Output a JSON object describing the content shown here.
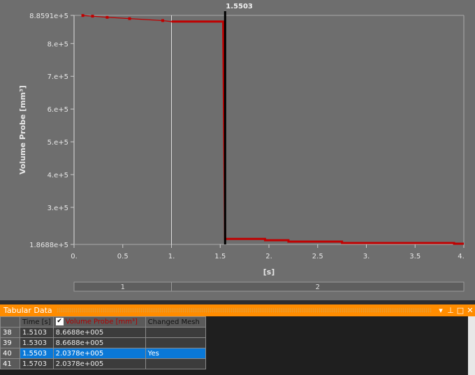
{
  "chart_data": {
    "type": "line",
    "ylabel": "Volume Probe [mm³]",
    "xlabel": "[s]",
    "xlim": [
      0,
      4
    ],
    "ylim": [
      186880,
      885910
    ],
    "xticks": [
      "0.",
      "0.5",
      "1.",
      "1.5",
      "2.",
      "2.5",
      "3.",
      "3.5",
      "4."
    ],
    "yticks": [
      {
        "v": 885910,
        "label": "8.8591e+5"
      },
      {
        "v": 800000,
        "label": "8.e+5"
      },
      {
        "v": 700000,
        "label": "7.e+5"
      },
      {
        "v": 600000,
        "label": "6.e+5"
      },
      {
        "v": 500000,
        "label": "5.e+5"
      },
      {
        "v": 400000,
        "label": "4.e+5"
      },
      {
        "v": 300000,
        "label": "3.e+5"
      },
      {
        "v": 186880,
        "label": "1.8688e+5"
      }
    ],
    "cursor": {
      "x": 1.5503,
      "label": "1.5503"
    },
    "step_divider": 1.0,
    "steps": [
      "1",
      "2"
    ],
    "series": [
      {
        "name": "Volume Probe [mm³]",
        "color": "#c00000",
        "points": [
          [
            0.09,
            885500
          ],
          [
            0.19,
            883500
          ],
          [
            0.34,
            880000
          ],
          [
            0.57,
            876000
          ],
          [
            0.91,
            870000
          ],
          [
            1.0,
            866880
          ],
          [
            1.5303,
            866880
          ],
          [
            1.5503,
            203780
          ],
          [
            1.96,
            203780
          ],
          [
            1.96,
            199700
          ],
          [
            2.2,
            199700
          ],
          [
            2.2,
            195500
          ],
          [
            2.75,
            195500
          ],
          [
            2.75,
            191200
          ],
          [
            3.9,
            191200
          ],
          [
            3.9,
            189100
          ],
          [
            4.0,
            189100
          ]
        ]
      }
    ]
  },
  "panel": {
    "title": "Tabular Data",
    "menu": "▾",
    "pin": "⊥",
    "max": "□",
    "close": "✕"
  },
  "table": {
    "headers": [
      "Time [s]",
      "Volume Probe [mm³]",
      "Changed Mesh"
    ],
    "check": "✔",
    "rows": [
      {
        "n": "38",
        "t": "1.5103",
        "v": "8.6688e+005",
        "m": ""
      },
      {
        "n": "39",
        "t": "1.5303",
        "v": "8.6688e+005",
        "m": ""
      },
      {
        "n": "40",
        "t": "1.5503",
        "v": "2.0378e+005",
        "m": "Yes"
      },
      {
        "n": "41",
        "t": "1.5703",
        "v": "2.0378e+005",
        "m": ""
      }
    ]
  }
}
